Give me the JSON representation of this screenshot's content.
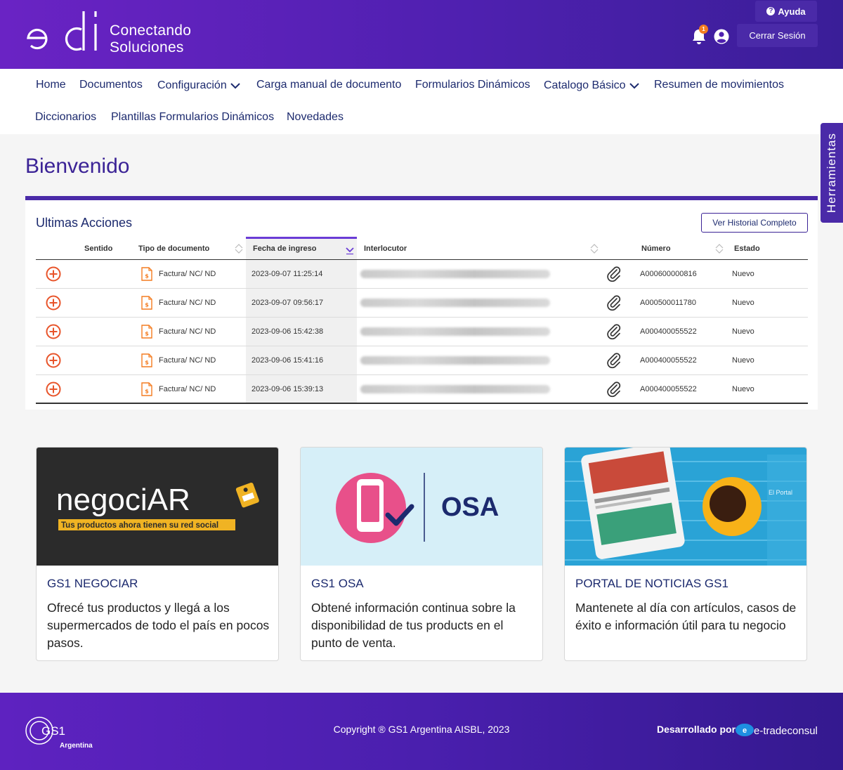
{
  "header": {
    "tagline_line1": "Conectando",
    "tagline_line2": "Soluciones",
    "help_label": "Ayuda",
    "notification_count": "1",
    "logout_label": "Cerrar Sesión",
    "brand_colors": {
      "primary": "#4a2aa8",
      "accent": "#f47c20"
    }
  },
  "nav": {
    "items": [
      "Home",
      "Documentos",
      "Configuración",
      "Carga manual de documento",
      "Formularios Dinámicos",
      "Catalogo Básico",
      "Resumen de movimientos",
      "Diccionarios",
      "Plantillas Formularios Dinámicos",
      "Novedades"
    ]
  },
  "side_tab": "Herramientas",
  "page_title": "Bienvenido",
  "actions": {
    "title": "Ultimas Acciones",
    "history_button": "Ver Historial Completo",
    "columns": [
      "Sentido",
      "Tipo de documento",
      "Fecha de ingreso",
      "Interlocutor",
      "Número",
      "Estado"
    ],
    "rows": [
      {
        "tipo": "Factura/ NC/ ND",
        "fecha": "2023-09-07 11:25:14",
        "numero": "A000600000816",
        "estado": "Nuevo"
      },
      {
        "tipo": "Factura/ NC/ ND",
        "fecha": "2023-09-07 09:56:17",
        "numero": "A000500011780",
        "estado": "Nuevo"
      },
      {
        "tipo": "Factura/ NC/ ND",
        "fecha": "2023-09-06 15:42:38",
        "numero": "A000400055522",
        "estado": "Nuevo"
      },
      {
        "tipo": "Factura/ NC/ ND",
        "fecha": "2023-09-06 15:41:16",
        "numero": "A000400055522",
        "estado": "Nuevo"
      },
      {
        "tipo": "Factura/ NC/ ND",
        "fecha": "2023-09-06 15:39:13",
        "numero": "A000400055522",
        "estado": "Nuevo"
      }
    ]
  },
  "cards": [
    {
      "image_word": "negociAR",
      "image_slogan": "Tus productos ahora tienen su red social",
      "title": "GS1 NEGOCIAR",
      "text": "Ofrecé tus productos y llegá a los supermercados de todo el país en pocos pasos."
    },
    {
      "image_word": "OSA",
      "title": "GS1 OSA",
      "text": "Obtené información continua sobre la disponibilidad de tus products en el punto de venta."
    },
    {
      "image_word": "El Portal",
      "title": "PORTAL DE NOTICIAS GS1",
      "text": "Mantenete al día con artículos, casos de éxito e información útil para tu negocio"
    }
  ],
  "footer": {
    "copyright": "Copyright ® GS1 Argentina AISBL, 2023",
    "developed_by": "Desarrollado por",
    "gs1_label": "Argentina",
    "etrade_label": "e-tradeconsult"
  }
}
